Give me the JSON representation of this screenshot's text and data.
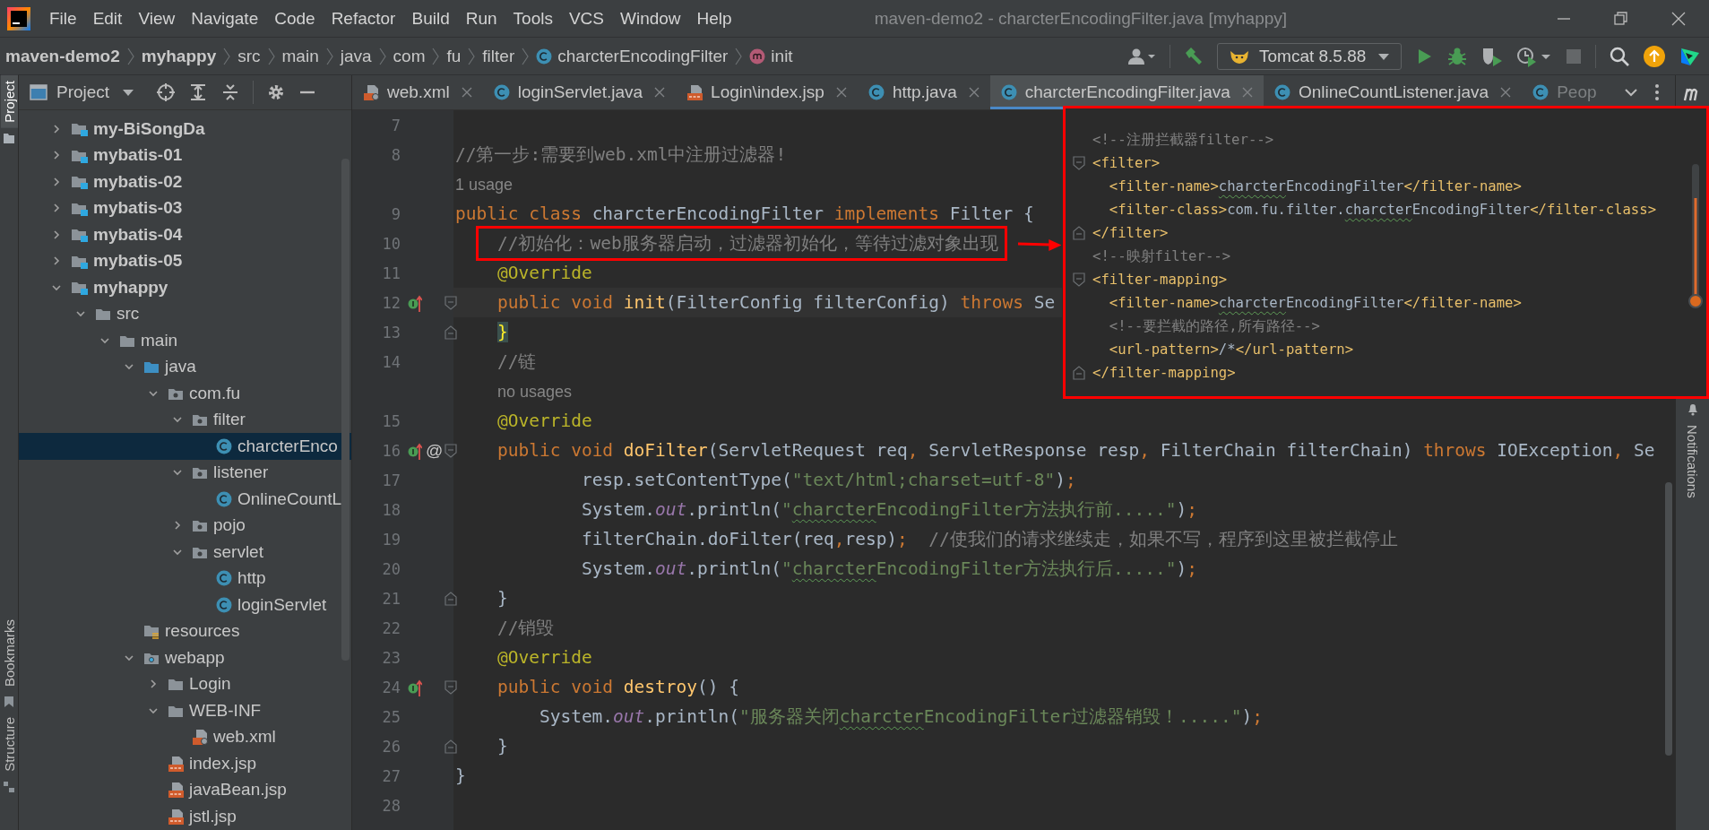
{
  "window": {
    "title": "maven-demo2 - charcterEncodingFilter.java [myhappy]"
  },
  "menu": [
    {
      "label": "File"
    },
    {
      "label": "Edit"
    },
    {
      "label": "View"
    },
    {
      "label": "Navigate"
    },
    {
      "label": "Code"
    },
    {
      "label": "Refactor"
    },
    {
      "label": "Build"
    },
    {
      "label": "Run"
    },
    {
      "label": "Tools"
    },
    {
      "label": "VCS"
    },
    {
      "label": "Window"
    },
    {
      "label": "Help"
    }
  ],
  "breadcrumbs": [
    {
      "text": "maven-demo2",
      "bold": true
    },
    {
      "text": "myhappy",
      "bold": true
    },
    {
      "text": "src",
      "bold": false
    },
    {
      "text": "main",
      "bold": false
    },
    {
      "text": "java",
      "bold": false
    },
    {
      "text": "com",
      "bold": false
    },
    {
      "text": "fu",
      "bold": false
    },
    {
      "text": "filter",
      "bold": false
    },
    {
      "text": "charcterEncodingFilter",
      "kind": "class",
      "bold": false
    },
    {
      "text": "init",
      "kind": "method",
      "bold": false
    }
  ],
  "toolbar": {
    "run_config": "Tomcat 8.5.88",
    "stop_disabled": true
  },
  "left_tool_strip": [
    {
      "label": "Project",
      "selected": true
    },
    {
      "label": "Bookmarks",
      "selected": false
    },
    {
      "label": "Structure",
      "selected": false
    }
  ],
  "right_tool_strip": [
    {
      "label": "Notifications",
      "selected": false
    }
  ],
  "project": {
    "title": "Project",
    "tree": [
      {
        "label": "my-BiSongDa",
        "kind": "module",
        "bold": true,
        "expanded": false,
        "selected": false
      },
      {
        "label": "mybatis-01",
        "kind": "module",
        "bold": true,
        "expanded": false,
        "selected": false
      },
      {
        "label": "mybatis-02",
        "kind": "module",
        "bold": true,
        "expanded": false,
        "selected": false
      },
      {
        "label": "mybatis-03",
        "kind": "module",
        "bold": true,
        "expanded": false,
        "selected": false
      },
      {
        "label": "mybatis-04",
        "kind": "module",
        "bold": true,
        "expanded": false,
        "selected": false
      },
      {
        "label": "mybatis-05",
        "kind": "module",
        "bold": true,
        "expanded": false,
        "selected": false
      },
      {
        "label": "myhappy",
        "kind": "module",
        "bold": true,
        "expanded": true,
        "selected": false,
        "children": [
          {
            "label": "src",
            "kind": "folder",
            "expanded": true,
            "selected": false,
            "children": [
              {
                "label": "main",
                "kind": "folder",
                "expanded": true,
                "selected": false,
                "children": [
                  {
                    "label": "java",
                    "kind": "source",
                    "expanded": true,
                    "selected": false,
                    "children": [
                      {
                        "label": "com.fu",
                        "kind": "package",
                        "expanded": true,
                        "selected": false,
                        "children": [
                          {
                            "label": "filter",
                            "kind": "package",
                            "expanded": true,
                            "selected": false,
                            "children": [
                              {
                                "label": "charcterEnco",
                                "kind": "class",
                                "selected": true
                              }
                            ]
                          },
                          {
                            "label": "listener",
                            "kind": "package",
                            "expanded": true,
                            "selected": false,
                            "children": [
                              {
                                "label": "OnlineCountL",
                                "kind": "class",
                                "selected": false
                              }
                            ]
                          },
                          {
                            "label": "pojo",
                            "kind": "package",
                            "expanded": false,
                            "selected": false
                          },
                          {
                            "label": "servlet",
                            "kind": "package",
                            "expanded": true,
                            "selected": false,
                            "children": [
                              {
                                "label": "http",
                                "kind": "class",
                                "selected": false
                              },
                              {
                                "label": "loginServlet",
                                "kind": "class",
                                "selected": false
                              }
                            ]
                          }
                        ]
                      }
                    ]
                  },
                  {
                    "label": "resources",
                    "kind": "resources",
                    "selected": false
                  },
                  {
                    "label": "webapp",
                    "kind": "web",
                    "expanded": true,
                    "selected": false,
                    "children": [
                      {
                        "label": "Login",
                        "kind": "folder",
                        "expanded": false,
                        "selected": false
                      },
                      {
                        "label": "WEB-INF",
                        "kind": "folder",
                        "expanded": true,
                        "selected": false,
                        "children": [
                          {
                            "label": "web.xml",
                            "kind": "xml",
                            "selected": false
                          }
                        ]
                      },
                      {
                        "label": "index.jsp",
                        "kind": "jsp",
                        "selected": false
                      },
                      {
                        "label": "javaBean.jsp",
                        "kind": "jsp",
                        "selected": false
                      },
                      {
                        "label": "jstl.jsp",
                        "kind": "jsp",
                        "selected": false
                      }
                    ]
                  }
                ]
              }
            ]
          }
        ]
      }
    ]
  },
  "editor": {
    "tabs": [
      {
        "label": "web.xml",
        "kind": "xml",
        "selected": false,
        "closable": true
      },
      {
        "label": "loginServlet.java",
        "kind": "class",
        "selected": false,
        "closable": true
      },
      {
        "label": "Login\\index.jsp",
        "kind": "jsp",
        "selected": false,
        "closable": true
      },
      {
        "label": "http.java",
        "kind": "class",
        "selected": false,
        "closable": true
      },
      {
        "label": "charcterEncodingFilter.java",
        "kind": "class",
        "selected": true,
        "closable": true
      },
      {
        "label": "OnlineCountListener.java",
        "kind": "class",
        "selected": false,
        "closable": true
      },
      {
        "label": "Peop",
        "kind": "class",
        "selected": false,
        "closable": false
      }
    ],
    "lines": [
      {
        "number": "7",
        "current": false
      },
      {
        "number": "8",
        "current": false,
        "tokens": [
          {
            "kind": "comment",
            "text": "//第一步:需要到web.xml中注册过滤器!"
          }
        ]
      },
      {
        "kind": "hint",
        "tokens": [
          {
            "kind": "hint",
            "text": "1 usage"
          }
        ]
      },
      {
        "number": "9",
        "current": false,
        "tokens": [
          {
            "kind": "keyword",
            "text": "public class "
          },
          {
            "kind": "plain",
            "text": "charcterEncodingFilter "
          },
          {
            "kind": "keyword",
            "text": "implements "
          },
          {
            "kind": "plain",
            "text": "Filter {"
          }
        ]
      },
      {
        "number": "10",
        "current": false,
        "tokens": [
          {
            "kind": "comment",
            "text": "    //初始化：web服务器启动，过滤器初始化，等待过滤对象出现",
            "annotated": true
          }
        ]
      },
      {
        "number": "11",
        "current": false,
        "tokens": [
          {
            "kind": "annotation",
            "text": "    @Override"
          }
        ]
      },
      {
        "number": "12",
        "current": true,
        "implements_marker": true,
        "fold_open": true,
        "tokens": [
          {
            "kind": "keyword",
            "text": "    public void "
          },
          {
            "kind": "method",
            "text": "init"
          },
          {
            "kind": "plain",
            "text": "(FilterConfig filterConfig) "
          },
          {
            "kind": "keyword",
            "text": "throws "
          },
          {
            "kind": "plain",
            "text": "Se"
          }
        ]
      },
      {
        "number": "13",
        "current": false,
        "fold_close": true,
        "tokens": [
          {
            "kind": "plain",
            "text": "    }",
            "matched": true
          }
        ]
      },
      {
        "number": "14",
        "current": false,
        "tokens": [
          {
            "kind": "comment",
            "text": "    //链"
          }
        ]
      },
      {
        "kind": "hint",
        "tokens": [
          {
            "kind": "hint",
            "text": "    no usages"
          }
        ]
      },
      {
        "number": "15",
        "current": false,
        "tokens": [
          {
            "kind": "annotation",
            "text": "    @Override"
          }
        ]
      },
      {
        "number": "16",
        "current": false,
        "implements_marker": true,
        "gutter_text": "@",
        "fold_open": true,
        "tokens": [
          {
            "kind": "keyword",
            "text": "    public void "
          },
          {
            "kind": "method",
            "text": "doFilter"
          },
          {
            "kind": "plain",
            "text": "(ServletRequest req"
          },
          {
            "kind": "keyword",
            "text": ", "
          },
          {
            "kind": "plain",
            "text": "ServletResponse resp"
          },
          {
            "kind": "keyword",
            "text": ", "
          },
          {
            "kind": "plain",
            "text": "FilterChain filterChain) "
          },
          {
            "kind": "keyword",
            "text": "throws "
          },
          {
            "kind": "plain",
            "text": "IOException"
          },
          {
            "kind": "keyword",
            "text": ", "
          },
          {
            "kind": "plain",
            "text": "Se"
          }
        ]
      },
      {
        "number": "17",
        "current": false,
        "tokens": [
          {
            "kind": "plain",
            "text": "            resp.setContentType("
          },
          {
            "kind": "string",
            "text": "\"text/html;charset=utf-8\""
          },
          {
            "kind": "plain",
            "text": ")"
          },
          {
            "kind": "keyword",
            "text": ";"
          }
        ]
      },
      {
        "number": "18",
        "current": false,
        "tokens": [
          {
            "kind": "plain",
            "text": "            System."
          },
          {
            "kind": "field",
            "text": "out"
          },
          {
            "kind": "plain",
            "text": ".println("
          },
          {
            "kind": "string",
            "text": "\""
          },
          {
            "kind": "string",
            "text": "charcter",
            "typo": true
          },
          {
            "kind": "string",
            "text": "EncodingFilter方法执行前.....\""
          },
          {
            "kind": "plain",
            "text": ")"
          },
          {
            "kind": "keyword",
            "text": ";"
          }
        ]
      },
      {
        "number": "19",
        "current": false,
        "tokens": [
          {
            "kind": "plain",
            "text": "            filterChain.doFilter(req"
          },
          {
            "kind": "keyword",
            "text": ","
          },
          {
            "kind": "plain",
            "text": "resp)"
          },
          {
            "kind": "keyword",
            "text": ";"
          },
          {
            "kind": "comment",
            "text": "  //使我们的请求继续走，如果不写，程序到这里被拦截停止"
          }
        ]
      },
      {
        "number": "20",
        "current": false,
        "tokens": [
          {
            "kind": "plain",
            "text": "            System."
          },
          {
            "kind": "field",
            "text": "out"
          },
          {
            "kind": "plain",
            "text": ".println("
          },
          {
            "kind": "string",
            "text": "\""
          },
          {
            "kind": "string",
            "text": "charcter",
            "typo": true
          },
          {
            "kind": "string",
            "text": "EncodingFilter方法执行后.....\""
          },
          {
            "kind": "plain",
            "text": ")"
          },
          {
            "kind": "keyword",
            "text": ";"
          }
        ]
      },
      {
        "number": "21",
        "current": false,
        "fold_close": true,
        "tokens": [
          {
            "kind": "plain",
            "text": "    }"
          }
        ]
      },
      {
        "number": "22",
        "current": false,
        "tokens": [
          {
            "kind": "comment",
            "text": "    //销毁"
          }
        ]
      },
      {
        "number": "23",
        "current": false,
        "tokens": [
          {
            "kind": "annotation",
            "text": "    @Override"
          }
        ]
      },
      {
        "number": "24",
        "current": false,
        "implements_marker": true,
        "fold_open": true,
        "tokens": [
          {
            "kind": "keyword",
            "text": "    public void "
          },
          {
            "kind": "method",
            "text": "destroy"
          },
          {
            "kind": "plain",
            "text": "() {"
          }
        ]
      },
      {
        "number": "25",
        "current": false,
        "tokens": [
          {
            "kind": "plain",
            "text": "        System."
          },
          {
            "kind": "field",
            "text": "out"
          },
          {
            "kind": "plain",
            "text": ".println("
          },
          {
            "kind": "string",
            "text": "\"服务器关闭"
          },
          {
            "kind": "string",
            "text": "charcter",
            "typo": true
          },
          {
            "kind": "string",
            "text": "EncodingFilter过滤器销毁！.....\""
          },
          {
            "kind": "plain",
            "text": ")"
          },
          {
            "kind": "keyword",
            "text": ";"
          }
        ]
      },
      {
        "number": "26",
        "current": false,
        "fold_close": true,
        "tokens": [
          {
            "kind": "plain",
            "text": "    }"
          }
        ]
      },
      {
        "number": "27",
        "current": false,
        "tokens": [
          {
            "kind": "plain",
            "text": "}"
          }
        ]
      },
      {
        "number": "28",
        "current": false
      }
    ]
  },
  "xml_snippet": {
    "lines": [
      {
        "tokens": [
          {
            "kind": "comment",
            "text": "<!--注册拦截器filter-->"
          }
        ]
      },
      {
        "fold_open": true,
        "tokens": [
          {
            "kind": "tag",
            "text": "<filter>"
          }
        ]
      },
      {
        "tokens": [
          {
            "kind": "tag",
            "text": "  <filter-name>"
          },
          {
            "kind": "text",
            "text": "charcter",
            "typo": true
          },
          {
            "kind": "text",
            "text": "EncodingFilter"
          },
          {
            "kind": "tag",
            "text": "</filter-name>"
          }
        ]
      },
      {
        "tokens": [
          {
            "kind": "tag",
            "text": "  <filter-class>"
          },
          {
            "kind": "text",
            "text": "com.fu.filter."
          },
          {
            "kind": "text",
            "text": "charcter",
            "typo": true
          },
          {
            "kind": "text",
            "text": "EncodingFilter"
          },
          {
            "kind": "tag",
            "text": "</filter-class>"
          }
        ]
      },
      {
        "fold_close": true,
        "tokens": [
          {
            "kind": "tag",
            "text": "</filter>"
          }
        ]
      },
      {
        "tokens": [
          {
            "kind": "comment",
            "text": "<!--映射filter-->"
          }
        ]
      },
      {
        "fold_open": true,
        "tokens": [
          {
            "kind": "tag",
            "text": "<filter-mapping>"
          }
        ]
      },
      {
        "tokens": [
          {
            "kind": "tag",
            "text": "  <filter-name>"
          },
          {
            "kind": "text",
            "text": "charcter",
            "typo": true
          },
          {
            "kind": "text",
            "text": "EncodingFilter"
          },
          {
            "kind": "tag",
            "text": "</filter-name>"
          }
        ]
      },
      {
        "tokens": [
          {
            "kind": "comment",
            "text": "  <!--要拦截的路径,所有路径-->"
          }
        ]
      },
      {
        "tokens": [
          {
            "kind": "tag",
            "text": "  <url-pattern>"
          },
          {
            "kind": "text",
            "text": "/*"
          },
          {
            "kind": "tag",
            "text": "</url-pattern>"
          }
        ]
      },
      {
        "fold_close": true,
        "tokens": [
          {
            "kind": "tag",
            "text": "</filter-mapping>"
          }
        ]
      }
    ]
  }
}
